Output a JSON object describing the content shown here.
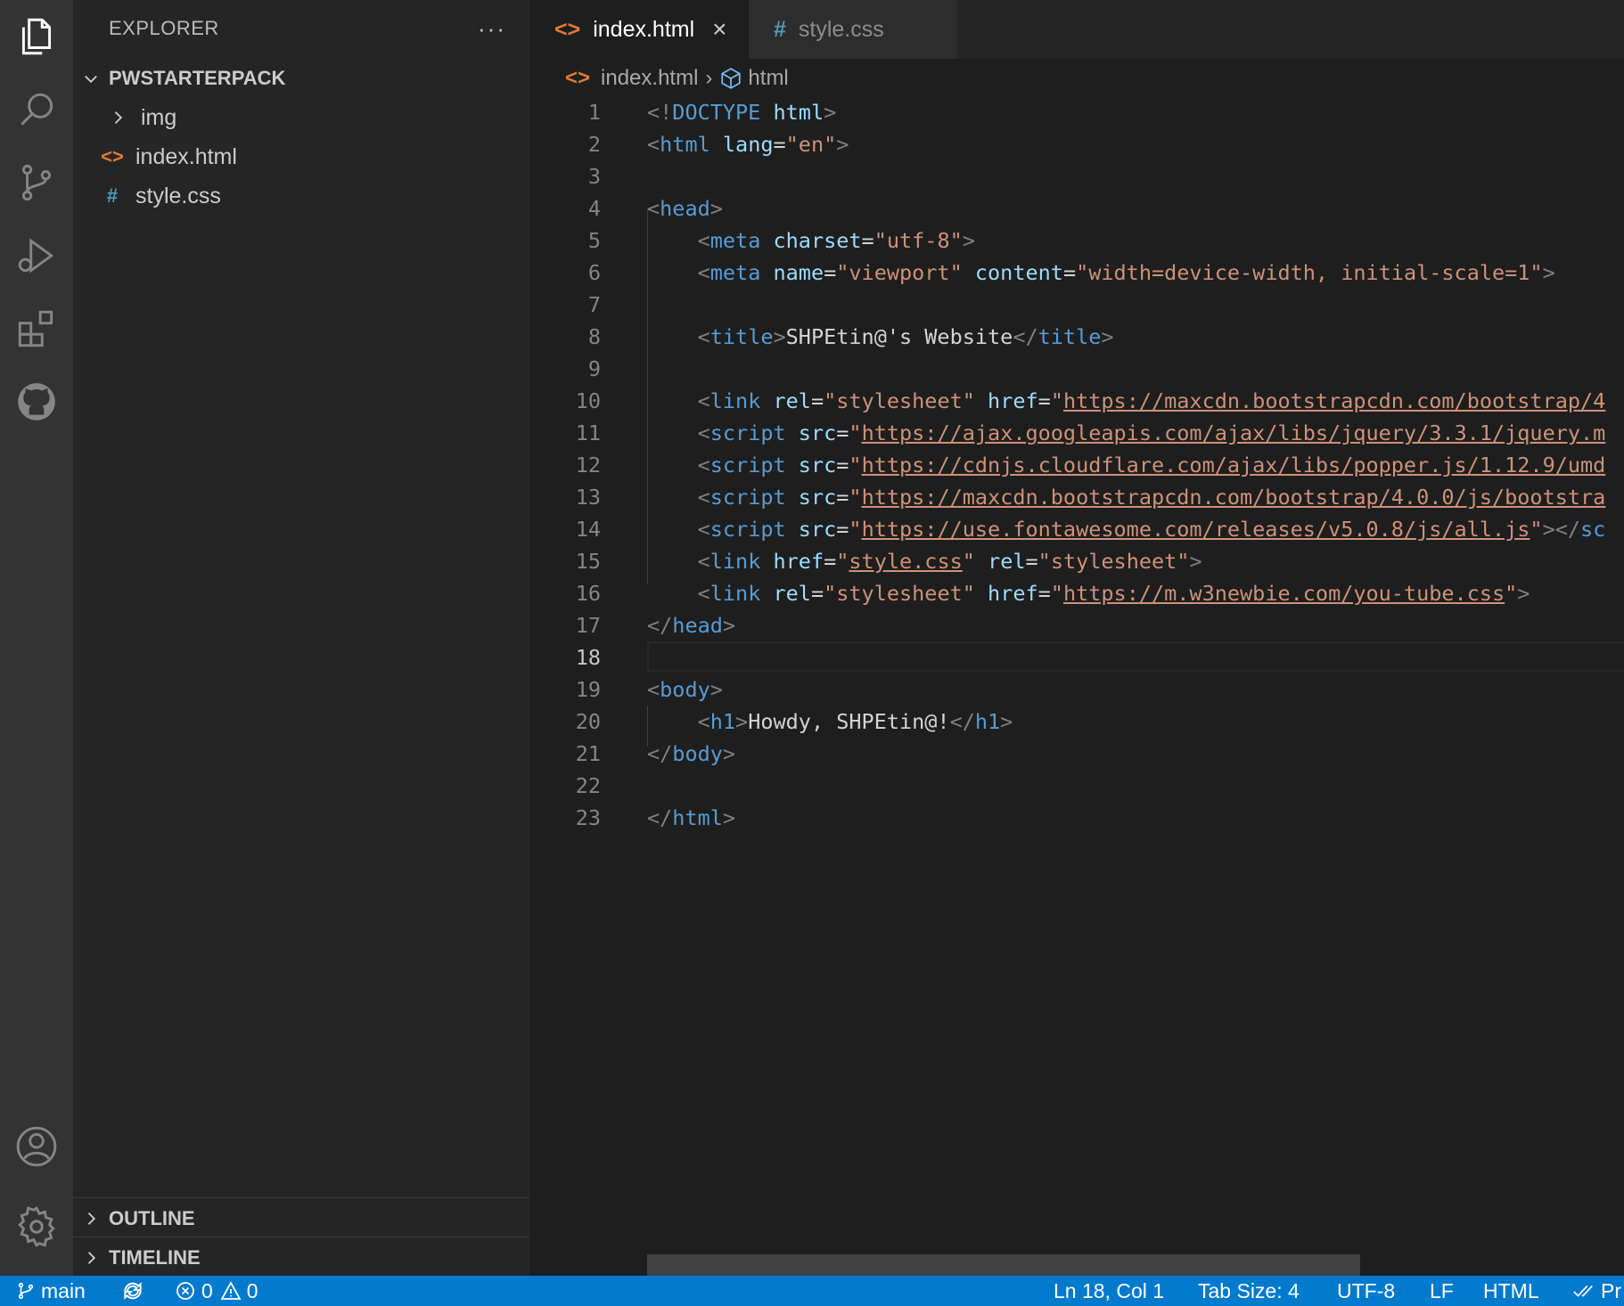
{
  "sidebar": {
    "title": "EXPLORER",
    "more_label": "···",
    "folder_name": "PWSTARTERPACK",
    "items": [
      {
        "label": "img",
        "icon": "chevron-right-icon"
      },
      {
        "label": "index.html",
        "icon": "html-file-icon",
        "icon_glyph": "<>",
        "icon_color": "#e37933"
      },
      {
        "label": "style.css",
        "icon": "css-file-icon",
        "icon_glyph": "#",
        "icon_color": "#519aba"
      }
    ],
    "outline_label": "OUTLINE",
    "timeline_label": "TIMELINE"
  },
  "tabs": [
    {
      "label": "index.html",
      "icon_glyph": "<>",
      "icon_color": "#e37933",
      "active": true,
      "close": "×"
    },
    {
      "label": "style.css",
      "icon_glyph": "#",
      "icon_color": "#519aba",
      "active": false
    }
  ],
  "breadcrumb": {
    "file": "index.html",
    "file_icon": "<>",
    "separator": "›",
    "symbol": "html"
  },
  "editor": {
    "current_line": 18,
    "line_numbers": [
      "1",
      "2",
      "3",
      "4",
      "5",
      "6",
      "7",
      "8",
      "9",
      "10",
      "11",
      "12",
      "13",
      "14",
      "15",
      "16",
      "17",
      "18",
      "19",
      "20",
      "21",
      "22",
      "23"
    ],
    "lines": [
      [
        [
          "p",
          "<!"
        ],
        [
          "tag",
          "DOCTYPE"
        ],
        [
          "txt",
          " "
        ],
        [
          "attr",
          "html"
        ],
        [
          "p",
          ">"
        ]
      ],
      [
        [
          "p",
          "<"
        ],
        [
          "tag",
          "html"
        ],
        [
          "txt",
          " "
        ],
        [
          "attr",
          "lang"
        ],
        [
          "txt",
          "="
        ],
        [
          "str",
          "\"en\""
        ],
        [
          "p",
          ">"
        ]
      ],
      [],
      [
        [
          "p",
          "<"
        ],
        [
          "tag",
          "head"
        ],
        [
          "p",
          ">"
        ]
      ],
      [
        [
          "txt",
          "    "
        ],
        [
          "p",
          "<"
        ],
        [
          "tag",
          "meta"
        ],
        [
          "txt",
          " "
        ],
        [
          "attr",
          "charset"
        ],
        [
          "txt",
          "="
        ],
        [
          "str",
          "\"utf-8\""
        ],
        [
          "p",
          ">"
        ]
      ],
      [
        [
          "txt",
          "    "
        ],
        [
          "p",
          "<"
        ],
        [
          "tag",
          "meta"
        ],
        [
          "txt",
          " "
        ],
        [
          "attr",
          "name"
        ],
        [
          "txt",
          "="
        ],
        [
          "str",
          "\"viewport\""
        ],
        [
          "txt",
          " "
        ],
        [
          "attr",
          "content"
        ],
        [
          "txt",
          "="
        ],
        [
          "str",
          "\"width=device-width, initial-scale=1\""
        ],
        [
          "p",
          ">"
        ]
      ],
      [],
      [
        [
          "txt",
          "    "
        ],
        [
          "p",
          "<"
        ],
        [
          "tag",
          "title"
        ],
        [
          "p",
          ">"
        ],
        [
          "txt",
          "SHPEtin@'s Website"
        ],
        [
          "p",
          "</"
        ],
        [
          "tag",
          "title"
        ],
        [
          "p",
          ">"
        ]
      ],
      [],
      [
        [
          "txt",
          "    "
        ],
        [
          "p",
          "<"
        ],
        [
          "tag",
          "link"
        ],
        [
          "txt",
          " "
        ],
        [
          "attr",
          "rel"
        ],
        [
          "txt",
          "="
        ],
        [
          "str",
          "\"stylesheet\""
        ],
        [
          "txt",
          " "
        ],
        [
          "attr",
          "href"
        ],
        [
          "txt",
          "="
        ],
        [
          "str",
          "\""
        ],
        [
          "url",
          "https://maxcdn.bootstrapcdn.com/bootstrap/4"
        ]
      ],
      [
        [
          "txt",
          "    "
        ],
        [
          "p",
          "<"
        ],
        [
          "tag",
          "script"
        ],
        [
          "txt",
          " "
        ],
        [
          "attr",
          "src"
        ],
        [
          "txt",
          "="
        ],
        [
          "str",
          "\""
        ],
        [
          "url",
          "https://ajax.googleapis.com/ajax/libs/jquery/3.3.1/jquery.m"
        ]
      ],
      [
        [
          "txt",
          "    "
        ],
        [
          "p",
          "<"
        ],
        [
          "tag",
          "script"
        ],
        [
          "txt",
          " "
        ],
        [
          "attr",
          "src"
        ],
        [
          "txt",
          "="
        ],
        [
          "str",
          "\""
        ],
        [
          "url",
          "https://cdnjs.cloudflare.com/ajax/libs/popper.js/1.12.9/umd"
        ]
      ],
      [
        [
          "txt",
          "    "
        ],
        [
          "p",
          "<"
        ],
        [
          "tag",
          "script"
        ],
        [
          "txt",
          " "
        ],
        [
          "attr",
          "src"
        ],
        [
          "txt",
          "="
        ],
        [
          "str",
          "\""
        ],
        [
          "url",
          "https://maxcdn.bootstrapcdn.com/bootstrap/4.0.0/js/bootstra"
        ]
      ],
      [
        [
          "txt",
          "    "
        ],
        [
          "p",
          "<"
        ],
        [
          "tag",
          "script"
        ],
        [
          "txt",
          " "
        ],
        [
          "attr",
          "src"
        ],
        [
          "txt",
          "="
        ],
        [
          "str",
          "\""
        ],
        [
          "url",
          "https://use.fontawesome.com/releases/v5.0.8/js/all.js"
        ],
        [
          "str",
          "\""
        ],
        [
          "p",
          "></"
        ],
        [
          "tag",
          "sc"
        ]
      ],
      [
        [
          "txt",
          "    "
        ],
        [
          "p",
          "<"
        ],
        [
          "tag",
          "link"
        ],
        [
          "txt",
          " "
        ],
        [
          "attr",
          "href"
        ],
        [
          "txt",
          "="
        ],
        [
          "str",
          "\""
        ],
        [
          "url",
          "style.css"
        ],
        [
          "str",
          "\""
        ],
        [
          "txt",
          " "
        ],
        [
          "attr",
          "rel"
        ],
        [
          "txt",
          "="
        ],
        [
          "str",
          "\"stylesheet\""
        ],
        [
          "p",
          ">"
        ]
      ],
      [
        [
          "txt",
          "    "
        ],
        [
          "p",
          "<"
        ],
        [
          "tag",
          "link"
        ],
        [
          "txt",
          " "
        ],
        [
          "attr",
          "rel"
        ],
        [
          "txt",
          "="
        ],
        [
          "str",
          "\"stylesheet\""
        ],
        [
          "txt",
          " "
        ],
        [
          "attr",
          "href"
        ],
        [
          "txt",
          "="
        ],
        [
          "str",
          "\""
        ],
        [
          "url",
          "https://m.w3newbie.com/you-tube.css"
        ],
        [
          "str",
          "\""
        ],
        [
          "p",
          ">"
        ]
      ],
      [
        [
          "p",
          "</"
        ],
        [
          "tag",
          "head"
        ],
        [
          "p",
          ">"
        ]
      ],
      [],
      [
        [
          "p",
          "<"
        ],
        [
          "tag",
          "body"
        ],
        [
          "p",
          ">"
        ]
      ],
      [
        [
          "txt",
          "    "
        ],
        [
          "p",
          "<"
        ],
        [
          "tag",
          "h1"
        ],
        [
          "p",
          ">"
        ],
        [
          "txt",
          "Howdy, SHPEtin@!"
        ],
        [
          "p",
          "</"
        ],
        [
          "tag",
          "h1"
        ],
        [
          "p",
          ">"
        ]
      ],
      [
        [
          "p",
          "</"
        ],
        [
          "tag",
          "body"
        ],
        [
          "p",
          ">"
        ]
      ],
      [],
      [
        [
          "p",
          "</"
        ],
        [
          "tag",
          "html"
        ],
        [
          "p",
          ">"
        ]
      ]
    ]
  },
  "status": {
    "branch": "main",
    "errors": "0",
    "warnings": "0",
    "position": "Ln 18, Col 1",
    "tab_size": "Tab Size: 4",
    "encoding": "UTF-8",
    "eol": "LF",
    "language": "HTML",
    "prettier": "Pr"
  },
  "colors": {
    "activity_bar": "#333333",
    "sidebar": "#252526",
    "editor": "#1e1e1e",
    "status_bar": "#007acc"
  }
}
